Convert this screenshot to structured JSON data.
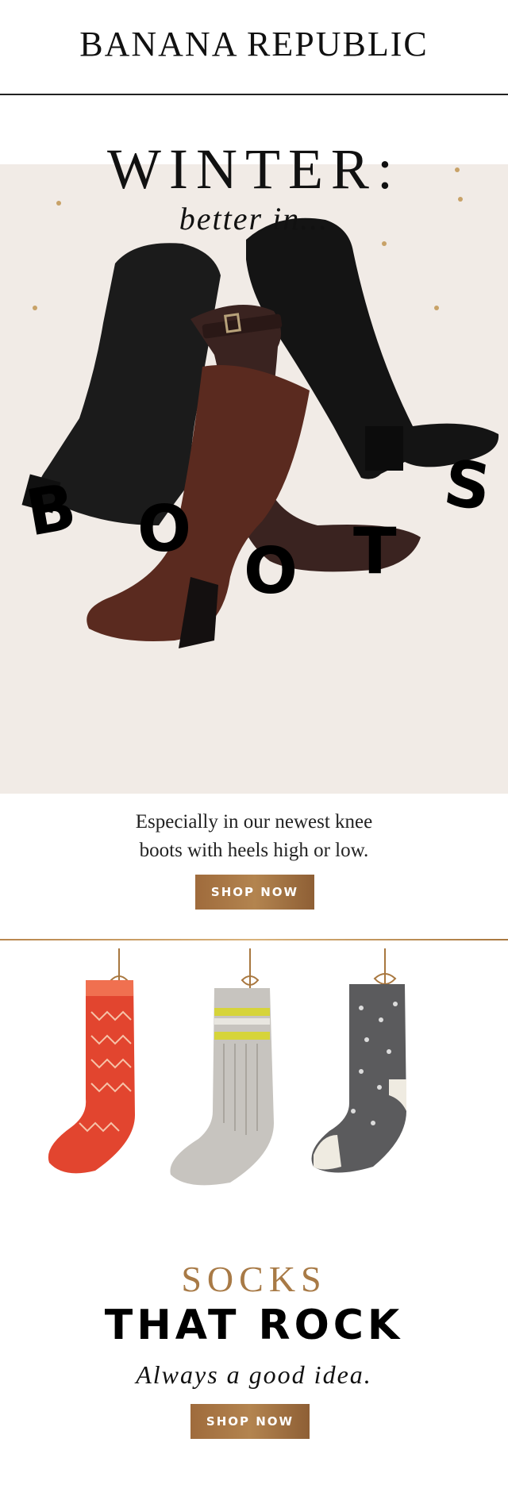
{
  "header": {
    "logo": "BANANA REPUBLIC"
  },
  "hero": {
    "title": "WINTER:",
    "subtitle": "better in...",
    "boots_letters": [
      "B",
      "O",
      "O",
      "T",
      "S"
    ]
  },
  "boots_section": {
    "copy_line1": "Especially in our newest knee",
    "copy_line2": "boots with heels high or low.",
    "cta": "SHOP NOW"
  },
  "socks_section": {
    "title": "SOCKS",
    "headline": "THAT ROCK",
    "tagline": "Always a good idea.",
    "cta": "SHOP NOW"
  },
  "colors": {
    "gold": "#a87a46",
    "button": "#9b6a3d",
    "hero_bg": "#f1ebe6"
  }
}
